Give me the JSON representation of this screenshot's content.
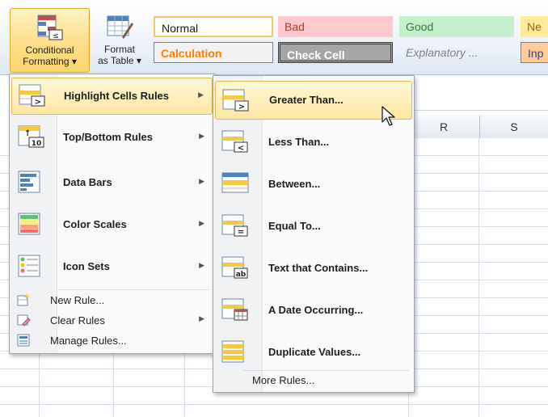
{
  "ribbon": {
    "conditional_formatting": {
      "line1": "Conditional",
      "line2": "Formatting ▾"
    },
    "format_as_table": {
      "line1": "Format",
      "line2": "as Table ▾"
    },
    "styles": {
      "normal": "Normal",
      "bad": "Bad",
      "good": "Good",
      "neutral": "Ne",
      "calculation": "Calculation",
      "check_cell": "Check Cell",
      "explanatory": "Explanatory ...",
      "input": "Inp"
    }
  },
  "sheet": {
    "columns": [
      "R",
      "S"
    ]
  },
  "menu": {
    "items": [
      {
        "label": "Highlight Cells Rules",
        "icon": "highlight-cells-icon",
        "has_submenu": true,
        "highlighted": true
      },
      {
        "label": "Top/Bottom Rules",
        "icon": "top-bottom-icon",
        "has_submenu": true
      },
      {
        "label": "Data Bars",
        "icon": "data-bars-icon",
        "has_submenu": true
      },
      {
        "label": "Color Scales",
        "icon": "color-scales-icon",
        "has_submenu": true
      },
      {
        "label": "Icon Sets",
        "icon": "icon-sets-icon",
        "has_submenu": true
      }
    ],
    "small_items": [
      {
        "label": "New Rule...",
        "icon": "new-rule-icon"
      },
      {
        "label": "Clear Rules",
        "icon": "clear-rules-icon",
        "has_submenu": true
      },
      {
        "label": "Manage Rules...",
        "icon": "manage-rules-icon"
      }
    ]
  },
  "submenu": {
    "items": [
      {
        "label": "Greater Than...",
        "icon": "greater-than-icon",
        "highlighted": true
      },
      {
        "label": "Less Than...",
        "icon": "less-than-icon"
      },
      {
        "label": "Between...",
        "icon": "between-icon"
      },
      {
        "label": "Equal To...",
        "icon": "equal-to-icon"
      },
      {
        "label": "Text that Contains...",
        "icon": "text-contains-icon"
      },
      {
        "label": "A Date Occurring...",
        "icon": "date-occurring-icon"
      },
      {
        "label": "Duplicate Values...",
        "icon": "duplicate-values-icon"
      }
    ],
    "more_rules": "More Rules..."
  },
  "colors": {
    "highlight": "#fde7a3",
    "accent": "#e3a72a",
    "ribbon_bg": "#eaf0f8"
  }
}
